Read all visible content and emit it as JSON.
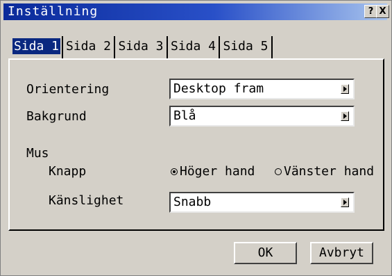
{
  "dialog": {
    "title": "Inställning",
    "help_label": "?",
    "close_label": "X"
  },
  "tabs": [
    {
      "label": "Sida 1",
      "active": true
    },
    {
      "label": "Sida 2",
      "active": false
    },
    {
      "label": "Sida 3",
      "active": false
    },
    {
      "label": "Sida 4",
      "active": false
    },
    {
      "label": "Sida 5",
      "active": false
    }
  ],
  "orientation": {
    "label": "Orientering",
    "value": "Desktop fram"
  },
  "background": {
    "label": "Bakgrund",
    "value": "Blå"
  },
  "mouse": {
    "label": "Mus",
    "button_label": "Knapp",
    "options": [
      {
        "label": "Höger hand",
        "selected": true
      },
      {
        "label": "Vänster hand",
        "selected": false
      }
    ],
    "sensitivity_label": "Känslighet",
    "sensitivity_value": "Snabb"
  },
  "buttons": {
    "ok": "OK",
    "cancel": "Avbryt"
  },
  "colors": {
    "title_start": "#0a2a9a",
    "title_end": "#a8c4ee",
    "active_tab": "#0a2880",
    "face": "#d4d0c8"
  }
}
